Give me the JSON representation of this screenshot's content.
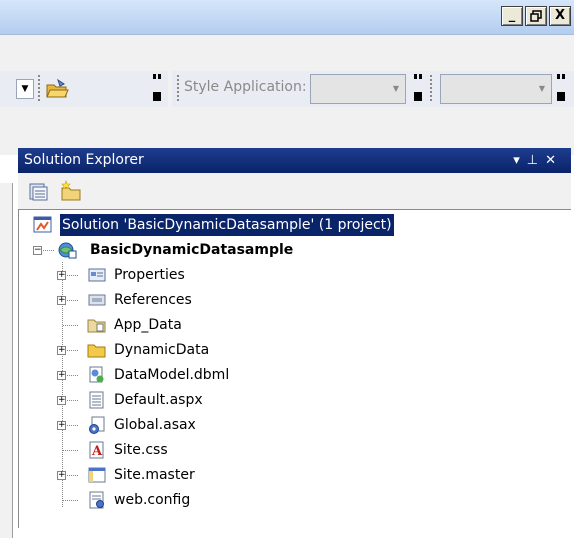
{
  "window": {
    "minimize_label": "_",
    "maximize_label": "🗗",
    "close_label": "X"
  },
  "toolbar": {
    "style_application_label": "Style Application:",
    "style_application_value": "",
    "second_combo_value": ""
  },
  "solution_explorer": {
    "title": "Solution Explorer",
    "controls": [
      "▾",
      "⊥",
      "✕"
    ],
    "solution_label": "Solution 'BasicDynamicDatasample' (1 project)",
    "project_label": "BasicDynamicDatasample",
    "items": [
      {
        "label": "Properties",
        "icon": "properties-icon",
        "expandable": true
      },
      {
        "label": "References",
        "icon": "references-icon",
        "expandable": true
      },
      {
        "label": "App_Data",
        "icon": "folder-icon",
        "expandable": false
      },
      {
        "label": "DynamicData",
        "icon": "folder-icon",
        "expandable": true
      },
      {
        "label": "DataModel.dbml",
        "icon": "dbml-file-icon",
        "expandable": true
      },
      {
        "label": "Default.aspx",
        "icon": "aspx-file-icon",
        "expandable": true
      },
      {
        "label": "Global.asax",
        "icon": "asax-file-icon",
        "expandable": true
      },
      {
        "label": "Site.css",
        "icon": "css-file-icon",
        "expandable": false
      },
      {
        "label": "Site.master",
        "icon": "master-file-icon",
        "expandable": true
      },
      {
        "label": "web.config",
        "icon": "config-file-icon",
        "expandable": false
      }
    ]
  },
  "colors": {
    "title_active": "#0a246a",
    "selection": "#0a246a",
    "toolbar_bg": "#f1f1f1"
  }
}
